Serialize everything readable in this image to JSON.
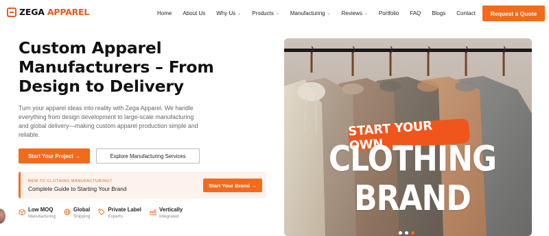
{
  "brand": {
    "name_part1": "ZEGA",
    "name_part2": "APPAREL"
  },
  "nav": {
    "items": [
      {
        "label": "Home",
        "dropdown": false
      },
      {
        "label": "About Us",
        "dropdown": false
      },
      {
        "label": "Why Us",
        "dropdown": true
      },
      {
        "label": "Products",
        "dropdown": true
      },
      {
        "label": "Manufacturing",
        "dropdown": true
      },
      {
        "label": "Reviews",
        "dropdown": true
      },
      {
        "label": "Portfolio",
        "dropdown": false
      },
      {
        "label": "FAQ",
        "dropdown": false
      },
      {
        "label": "Blogs",
        "dropdown": false
      },
      {
        "label": "Contact",
        "dropdown": false
      }
    ],
    "cta_label": "Request a Quote"
  },
  "hero": {
    "title": "Custom Apparel Manufacturers – From Design to Delivery",
    "lead": "Turn your apparel ideas into reality with Zega Apparel. We handle everything from design development to large-scale manufacturing and global delivery—making custom apparel production simple and reliable.",
    "primary_button": "Start Your Project →",
    "secondary_button": "Explore Manufacturing Services",
    "callout": {
      "kicker": "NEW TO CLOTHING MANUFACTURING?",
      "text": "Complete Guide to Starting Your Brand",
      "button": "Start Your Brand →"
    },
    "features": [
      {
        "title": "Low MOQ",
        "subtitle": "Manufacturing",
        "icon": "box-icon"
      },
      {
        "title": "Global",
        "subtitle": "Shipping",
        "icon": "globe-icon"
      },
      {
        "title": "Private Label",
        "subtitle": "Experts",
        "icon": "tag-icon"
      },
      {
        "title": "Vertically",
        "subtitle": "Integrated",
        "icon": "factory-icon"
      }
    ]
  },
  "hero_image": {
    "banner_text": "START YOUR OWN",
    "headline": "CLOTHING BRAND",
    "slides": 3,
    "active_slide": 3
  },
  "colors": {
    "accent": "#f26b1d",
    "accent_dark": "#e8581c",
    "text": "#111111",
    "muted": "#666666"
  }
}
